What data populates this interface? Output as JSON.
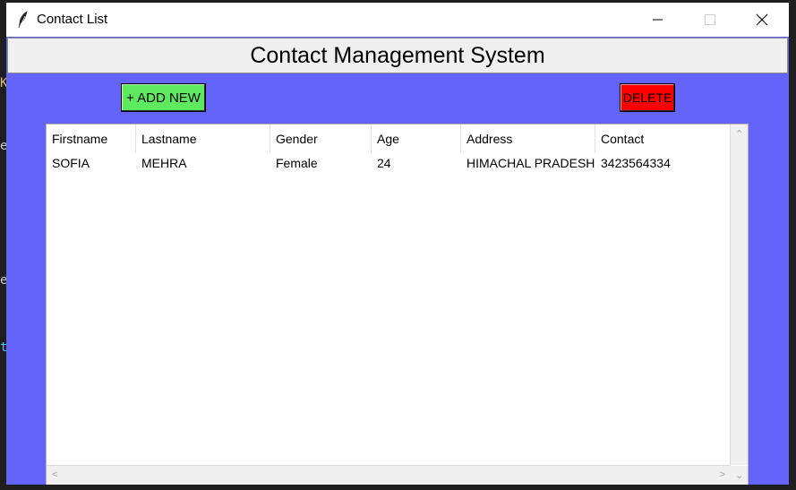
{
  "window": {
    "title": "Contact List",
    "minimize_icon": "minimize-icon",
    "maximize_icon": "maximize-icon",
    "close_icon": "close-icon",
    "app_icon": "feather-icon"
  },
  "header": {
    "title": "Contact Management System"
  },
  "toolbar": {
    "add_label": "+ ADD NEW",
    "delete_label": "DELETE",
    "add_color": "#5eea5e",
    "delete_color": "#ff0000"
  },
  "table": {
    "columns": [
      "Firstname",
      "Lastname",
      "Gender",
      "Age",
      "Address",
      "Contact"
    ],
    "rows": [
      [
        "SOFIA",
        "MEHRA",
        "Female",
        "24",
        "HIMACHAL PRADESH",
        "3423564334"
      ]
    ]
  },
  "colors": {
    "background": "#6464fa",
    "header_bg": "#f0f0f0"
  }
}
